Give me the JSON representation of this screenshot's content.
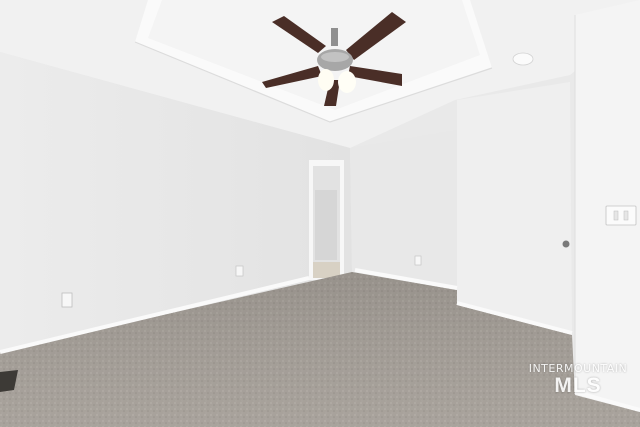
{
  "photo": {
    "scene": "empty-bedroom-interior",
    "colors": {
      "ceiling": "#f1f1f1",
      "tray": "#f7f7f7",
      "wall_left": "#ececec",
      "wall_back": "#e9e9e9",
      "wall_right": "#f3f3f3",
      "carpet": "#a59f98",
      "fan_blade": "#4a2e27",
      "fan_metal": "#a0a0a0",
      "baseboard": "#fafafa"
    }
  },
  "watermark": {
    "line1": "INTERMOUNTAIN",
    "line2": "MLS"
  }
}
